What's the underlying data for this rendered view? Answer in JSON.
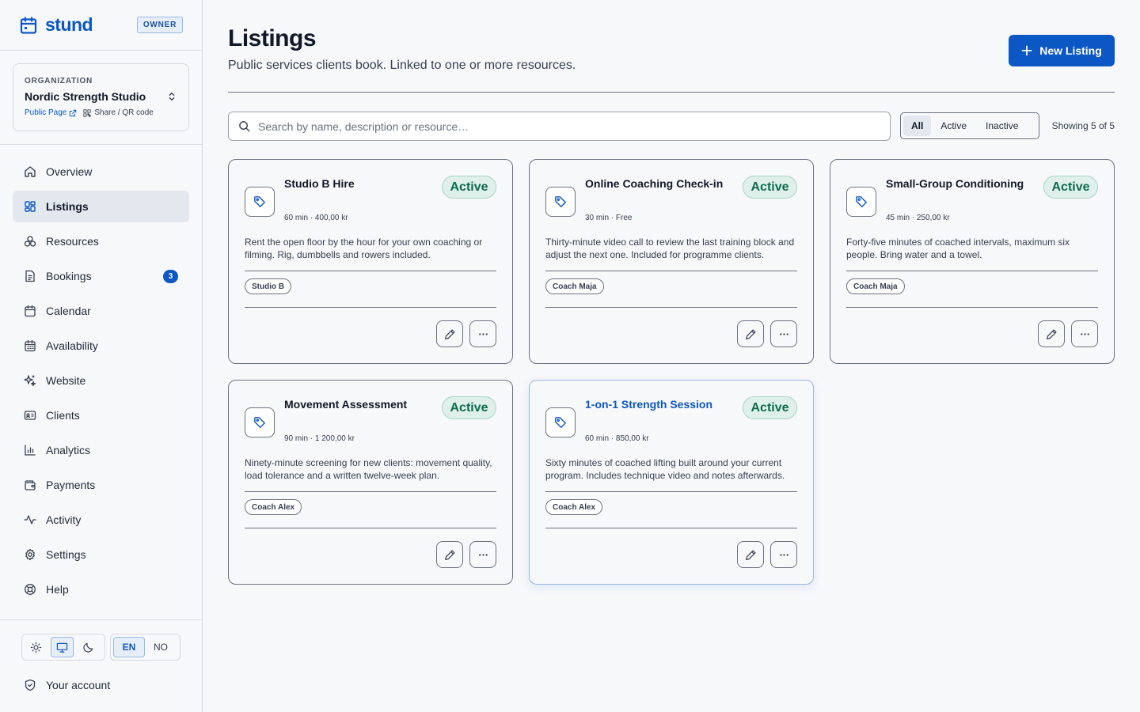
{
  "brand": {
    "name": "stund",
    "role_badge": "OWNER"
  },
  "organization": {
    "label": "ORGANIZATION",
    "name": "Nordic Strength Studio",
    "public_page": "Public Page",
    "share": "Share / QR code"
  },
  "nav": [
    {
      "id": "overview",
      "label": "Overview",
      "icon": "home-icon"
    },
    {
      "id": "listings",
      "label": "Listings",
      "icon": "grid-icon",
      "active": true
    },
    {
      "id": "resources",
      "label": "Resources",
      "icon": "boxes-icon"
    },
    {
      "id": "bookings",
      "label": "Bookings",
      "icon": "document-icon",
      "badge": "3"
    },
    {
      "id": "calendar",
      "label": "Calendar",
      "icon": "calendar-icon"
    },
    {
      "id": "availability",
      "label": "Availability",
      "icon": "calendar-days-icon"
    },
    {
      "id": "website",
      "label": "Website",
      "icon": "sparkles-icon"
    },
    {
      "id": "clients",
      "label": "Clients",
      "icon": "id-card-icon"
    },
    {
      "id": "analytics",
      "label": "Analytics",
      "icon": "bar-chart-icon"
    },
    {
      "id": "payments",
      "label": "Payments",
      "icon": "wallet-icon"
    },
    {
      "id": "activity",
      "label": "Activity",
      "icon": "activity-icon"
    },
    {
      "id": "settings",
      "label": "Settings",
      "icon": "gear-icon"
    },
    {
      "id": "help",
      "label": "Help",
      "icon": "lifebuoy-icon"
    }
  ],
  "theme": {
    "options": [
      "light",
      "system",
      "dark"
    ],
    "selected": "system"
  },
  "language": {
    "options": [
      "EN",
      "NO"
    ],
    "selected": "EN"
  },
  "account": {
    "label": "Your account"
  },
  "page": {
    "title": "Listings",
    "subtitle": "Public services clients book. Linked to one or more resources.",
    "new_button": "New Listing"
  },
  "search": {
    "placeholder": "Search by name, description or resource…",
    "value": ""
  },
  "filters": {
    "options": [
      "All",
      "Active",
      "Inactive"
    ],
    "selected": "All"
  },
  "showing": "Showing 5 of 5",
  "listings": [
    {
      "title": "Studio B Hire",
      "status": "Active",
      "meta": "60 min · 400,00 kr",
      "description": "Rent the open floor by the hour for your own coaching or filming. Rig, dumbbells and rowers included.",
      "resource": "Studio B"
    },
    {
      "title": "Online Coaching Check-in",
      "status": "Active",
      "meta": "30 min · Free",
      "description": "Thirty-minute video call to review the last training block and adjust the next one. Included for programme clients.",
      "resource": "Coach Maja"
    },
    {
      "title": "Small-Group Conditioning",
      "status": "Active",
      "meta": "45 min · 250,00 kr",
      "description": "Forty-five minutes of coached intervals, maximum six people. Bring water and a towel.",
      "resource": "Coach Maja"
    },
    {
      "title": "Movement Assessment",
      "status": "Active",
      "meta": "90 min · 1 200,00 kr",
      "description": "Ninety-minute screening for new clients: movement quality, load tolerance and a written twelve-week plan.",
      "resource": "Coach Alex"
    },
    {
      "title": "1-on-1 Strength Session",
      "status": "Active",
      "meta": "60 min · 850,00 kr",
      "description": "Sixty minutes of coached lifting built around your current program. Includes technique video and notes afterwards.",
      "resource": "Coach Alex",
      "highlight": true
    }
  ],
  "colors": {
    "accent": "#0b57c4",
    "status_active_bg": "#dff0ea",
    "status_active_text": "#0e6b4f"
  }
}
